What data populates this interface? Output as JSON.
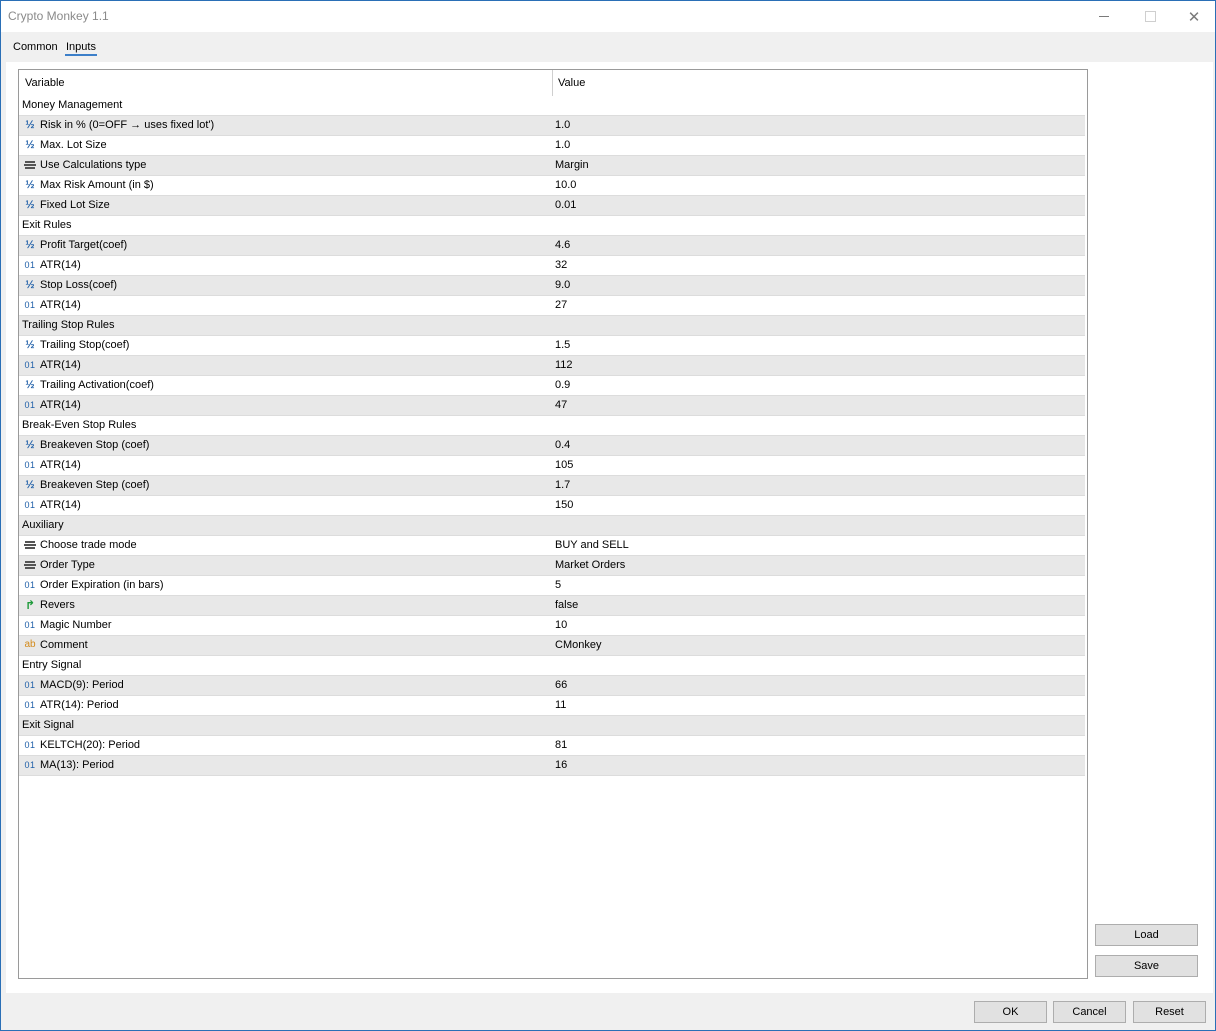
{
  "window": {
    "title": "Crypto Monkey 1.1"
  },
  "tabs": [
    {
      "label": "Common"
    },
    {
      "label": "Inputs"
    }
  ],
  "table": {
    "headers": {
      "variable": "Variable",
      "value": "Value"
    },
    "rows": [
      {
        "type": "group",
        "name": "Money Management",
        "value": ""
      },
      {
        "type": "frac",
        "icon": "fraction-icon",
        "name": "Risk in % (0=OFF → uses fixed lot')",
        "value": "1.0"
      },
      {
        "type": "frac",
        "icon": "fraction-icon",
        "name": "Max. Lot Size",
        "value": "1.0"
      },
      {
        "type": "enum",
        "icon": "enum-icon",
        "name": "Use Calculations type",
        "value": "Margin"
      },
      {
        "type": "frac",
        "icon": "fraction-icon",
        "name": "Max Risk Amount (in $)",
        "value": "10.0"
      },
      {
        "type": "frac",
        "icon": "fraction-icon",
        "name": "Fixed Lot Size",
        "value": "0.01"
      },
      {
        "type": "group",
        "name": "Exit Rules",
        "value": ""
      },
      {
        "type": "frac",
        "icon": "fraction-icon",
        "name": "Profit Target(coef)",
        "value": "4.6"
      },
      {
        "type": "int",
        "icon": "integer-icon",
        "name": "ATR(14)",
        "value": "32"
      },
      {
        "type": "frac",
        "icon": "fraction-icon",
        "name": "Stop Loss(coef)",
        "value": "9.0"
      },
      {
        "type": "int",
        "icon": "integer-icon",
        "name": "ATR(14)",
        "value": "27"
      },
      {
        "type": "group",
        "name": "Trailing Stop Rules",
        "value": ""
      },
      {
        "type": "frac",
        "icon": "fraction-icon",
        "name": "Trailing Stop(coef)",
        "value": "1.5"
      },
      {
        "type": "int",
        "icon": "integer-icon",
        "name": "ATR(14)",
        "value": "112"
      },
      {
        "type": "frac",
        "icon": "fraction-icon",
        "name": "Trailing Activation(coef)",
        "value": "0.9"
      },
      {
        "type": "int",
        "icon": "integer-icon",
        "name": "ATR(14)",
        "value": "47"
      },
      {
        "type": "group",
        "name": "Break-Even Stop Rules",
        "value": ""
      },
      {
        "type": "frac",
        "icon": "fraction-icon",
        "name": "Breakeven Stop (coef)",
        "value": "0.4"
      },
      {
        "type": "int",
        "icon": "integer-icon",
        "name": "ATR(14)",
        "value": "105"
      },
      {
        "type": "frac",
        "icon": "fraction-icon",
        "name": "Breakeven Step (coef)",
        "value": "1.7"
      },
      {
        "type": "int",
        "icon": "integer-icon",
        "name": "ATR(14)",
        "value": "150"
      },
      {
        "type": "group",
        "name": "Auxiliary",
        "value": ""
      },
      {
        "type": "enum",
        "icon": "enum-icon",
        "name": "Choose trade mode",
        "value": "BUY and SELL"
      },
      {
        "type": "enum",
        "icon": "enum-icon",
        "name": "Order Type",
        "value": "Market Orders"
      },
      {
        "type": "int",
        "icon": "integer-icon",
        "name": "Order Expiration (in bars)",
        "value": "5"
      },
      {
        "type": "bool",
        "icon": "boolean-icon",
        "name": "Revers",
        "value": "false"
      },
      {
        "type": "int",
        "icon": "integer-icon",
        "name": "Magic Number",
        "value": "10"
      },
      {
        "type": "str",
        "icon": "string-icon",
        "name": "Comment",
        "value": "CMonkey"
      },
      {
        "type": "group",
        "name": "Entry Signal",
        "value": ""
      },
      {
        "type": "int",
        "icon": "integer-icon",
        "name": "MACD(9): Period",
        "value": "66"
      },
      {
        "type": "int",
        "icon": "integer-icon",
        "name": "ATR(14): Period",
        "value": "11"
      },
      {
        "type": "group",
        "name": "Exit Signal",
        "value": ""
      },
      {
        "type": "int",
        "icon": "integer-icon",
        "name": "KELTCH(20): Period",
        "value": "81"
      },
      {
        "type": "int",
        "icon": "integer-icon",
        "name": "MA(13): Period",
        "value": "16"
      }
    ]
  },
  "buttons": {
    "load": "Load",
    "save": "Save",
    "ok": "OK",
    "cancel": "Cancel",
    "reset": "Reset"
  },
  "icon_glyphs": {
    "fraction-icon": "½",
    "integer-icon": "01",
    "boolean-icon": "↱",
    "string-icon": "ab"
  },
  "colors": {
    "accent": "#3c7fc9",
    "icon_blue": "#1f5fa8",
    "icon_green": "#1e9a3a",
    "icon_orange": "#d38a1a",
    "row_alt": "#e8e8e8"
  }
}
